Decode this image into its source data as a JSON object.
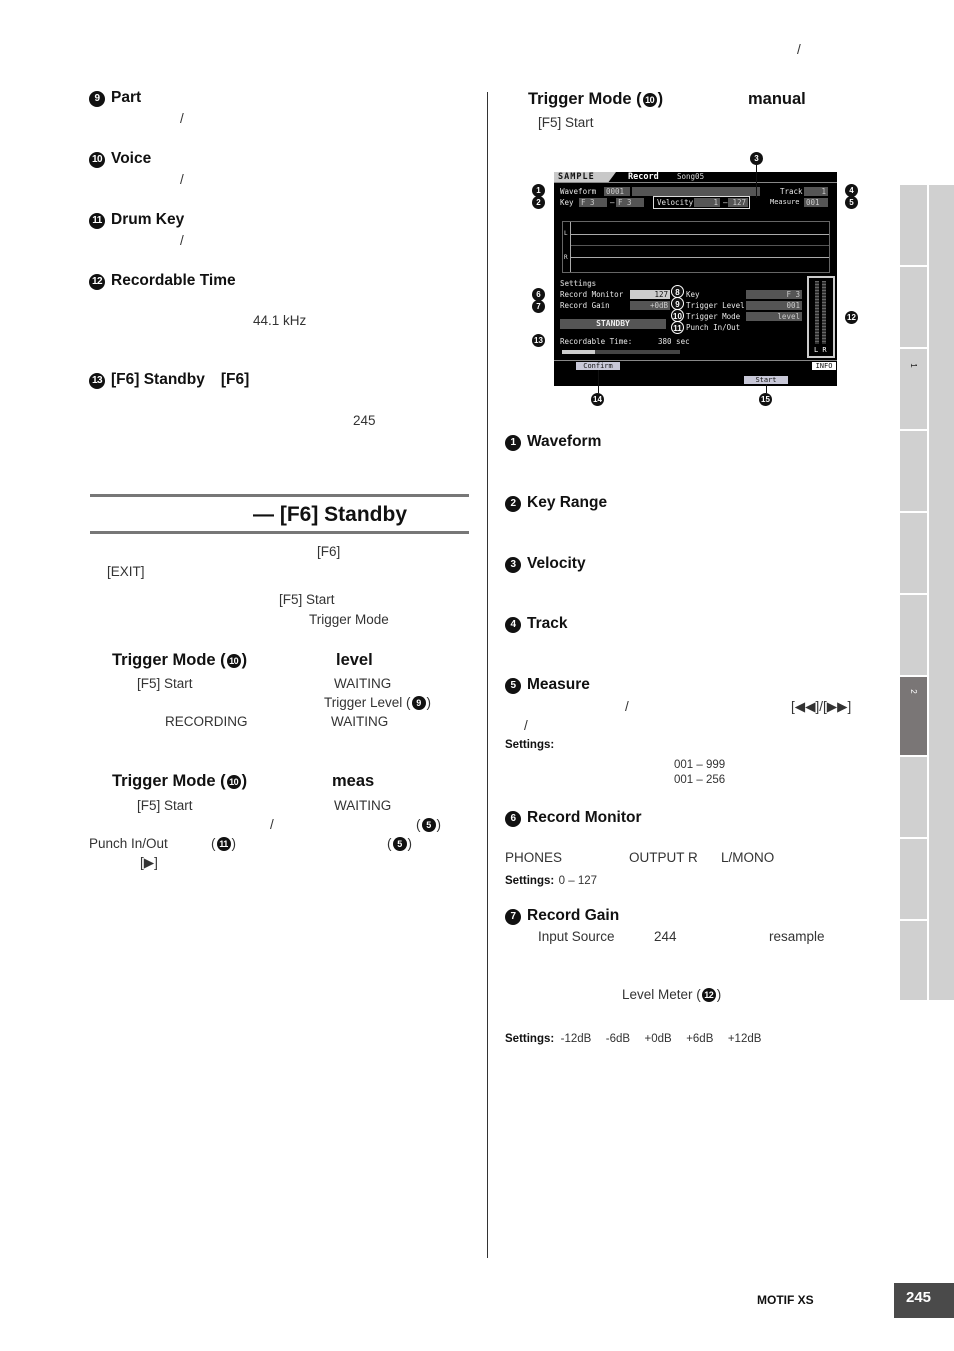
{
  "header": {
    "slash": "/"
  },
  "left_col": {
    "items": [
      {
        "num": "9",
        "title": "Part",
        "body": "/"
      },
      {
        "num": "10",
        "title": "Voice",
        "body": "/"
      },
      {
        "num": "11",
        "title": "Drum Key",
        "body": "/"
      },
      {
        "num": "12",
        "title": "Recordable Time",
        "body": "44.1 kHz"
      },
      {
        "num": "13",
        "title": "[F6] Standby",
        "title_extra": "[F6]",
        "body": "245"
      }
    ],
    "section": {
      "title": "— [F6] Standby",
      "p1_a": "[F6]",
      "p1_b": "[EXIT]",
      "p2_a": "[F5] Start",
      "p2_b": "Trigger Mode"
    },
    "trig_level": {
      "title": "Trigger Mode (",
      "num": "10",
      "title_end": ")",
      "value": "level",
      "l1_a": "[F5] Start",
      "l1_b": "WAITING",
      "l2_a": "Trigger Level (",
      "l2_num": "9",
      "l2_b": ")",
      "l3_a": "RECORDING",
      "l3_b": "WAITING"
    },
    "trig_meas": {
      "title": "Trigger Mode (",
      "num": "10",
      "title_end": ")",
      "value": "meas",
      "l1_a": "[F5] Start",
      "l1_b": "WAITING",
      "l2_a": "/",
      "l2_num": "5",
      "l3_a": "Punch In/Out",
      "l3_num": "11",
      "l3_num2": "5",
      "l4_a": "[▶]"
    }
  },
  "right_col": {
    "trig_manual": {
      "title": "Trigger Mode (",
      "num": "10",
      "title_end": ")",
      "value": "manual",
      "l1": "[F5] Start"
    },
    "lcd": {
      "mode": "SAMPLE",
      "page": "Record",
      "song": "Song05",
      "waveform_label": "Waveform",
      "waveform_value": "0001",
      "key_label": "Key",
      "key_low": "F  3",
      "key_high": "F  3",
      "velocity_label": "Velocity",
      "vel_low": "1",
      "vel_high": "127",
      "track_label": "Track",
      "track_value": "1",
      "measure_label": "Measure",
      "measure_value": "001",
      "ch_l": "L",
      "ch_r": "R",
      "settings_label": "Settings",
      "rec_monitor_label": "Record Monitor",
      "rec_monitor_value": "127",
      "rec_gain_label": "Record Gain",
      "rec_gain_value": "+0dB",
      "key2_label": "Key",
      "key2_value": "F  3",
      "trig_level_label": "Trigger Level",
      "trig_level_value": "001",
      "trig_mode_label": "Trigger Mode",
      "trig_mode_value": "level",
      "punch_label": "Punch In/Out",
      "standby": "STANDBY",
      "rec_time_label": "Recordable Time:",
      "rec_time_value": "380 sec",
      "rec_time_fraction": 0.28,
      "meter_lr": "L R",
      "confirm": "Confirm",
      "start": "Start",
      "info": "INFO",
      "callouts": [
        "1",
        "2",
        "3",
        "4",
        "5",
        "6",
        "7",
        "8",
        "9",
        "10",
        "11",
        "12",
        "13",
        "14",
        "15"
      ]
    },
    "items": [
      {
        "num": "1",
        "title": "Waveform"
      },
      {
        "num": "2",
        "title": "Key Range"
      },
      {
        "num": "3",
        "title": "Velocity"
      },
      {
        "num": "4",
        "title": "Track"
      },
      {
        "num": "5",
        "title": "Measure"
      },
      {
        "num": "6",
        "title": "Record Monitor"
      },
      {
        "num": "7",
        "title": "Record Gain"
      }
    ],
    "measure": {
      "l1_a": "/",
      "l1_b": "[◀◀]/[▶▶]",
      "l2": "/",
      "settings_label": "Settings:",
      "range1": "001 – 999",
      "range2": "001 – 256"
    },
    "monitor": {
      "a": "PHONES",
      "b": "OUTPUT R",
      "c": "L/MONO",
      "settings_label": "Settings:",
      "settings_value": "0 – 127"
    },
    "gain": {
      "a": "Input Source",
      "b": "244",
      "c": "resample",
      "meter": "Level Meter (",
      "meter_num": "12",
      "meter_end": ")",
      "settings_label": "Settings:",
      "settings_values": [
        "-12dB",
        "-6dB",
        "+0dB",
        "+6dB",
        "+12dB"
      ]
    }
  },
  "side_tabs": {
    "tab1": "1",
    "tab2": "2",
    "active_index": 6
  },
  "footer": {
    "product": "MOTIF XS",
    "page": "245"
  }
}
